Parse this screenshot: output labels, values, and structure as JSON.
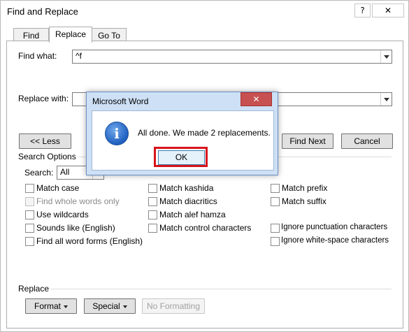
{
  "window": {
    "title": "Find and Replace",
    "help_glyph": "?",
    "close_glyph": "✕"
  },
  "tabs": [
    {
      "label": "Find",
      "active": false
    },
    {
      "label": "Replace",
      "active": true
    },
    {
      "label": "Go To",
      "active": false
    }
  ],
  "find": {
    "label": "Find what:",
    "value": "^f"
  },
  "replace": {
    "label": "Replace with:",
    "value": ""
  },
  "buttons": {
    "less": "<< Less",
    "find_next": "Find Next",
    "cancel": "Cancel",
    "format": "Format",
    "special": "Special",
    "no_formatting": "No Formatting"
  },
  "search_options": {
    "heading": "Search Options",
    "search_label": "Search:",
    "search_value": "All"
  },
  "checkboxes": {
    "col1": [
      {
        "label": "Match case",
        "checked": false,
        "disabled": false
      },
      {
        "label": "Find whole words only",
        "checked": false,
        "disabled": true
      },
      {
        "label": "Use wildcards",
        "checked": false,
        "disabled": false
      },
      {
        "label": "Sounds like (English)",
        "checked": false,
        "disabled": false
      },
      {
        "label": "Find all word forms (English)",
        "checked": false,
        "disabled": false
      }
    ],
    "col2": [
      {
        "label": "Match kashida",
        "checked": false
      },
      {
        "label": "Match diacritics",
        "checked": false
      },
      {
        "label": "Match alef hamza",
        "checked": false
      },
      {
        "label": "Match control characters",
        "checked": false
      }
    ],
    "col3": [
      {
        "label": "Match prefix",
        "checked": false
      },
      {
        "label": "Match suffix",
        "checked": false
      },
      {
        "label": "Ignore punctuation characters",
        "checked": false
      },
      {
        "label": "Ignore white-space characters",
        "checked": false
      }
    ]
  },
  "replace_section": {
    "heading": "Replace"
  },
  "modal": {
    "title": "Microsoft Word",
    "close_glyph": "✕",
    "icon": "information-icon",
    "icon_glyph": "i",
    "message": "All done. We made 2 replacements.",
    "ok": "OK"
  },
  "colors": {
    "highlight": "#d8141c",
    "close_red": "#c75050"
  }
}
